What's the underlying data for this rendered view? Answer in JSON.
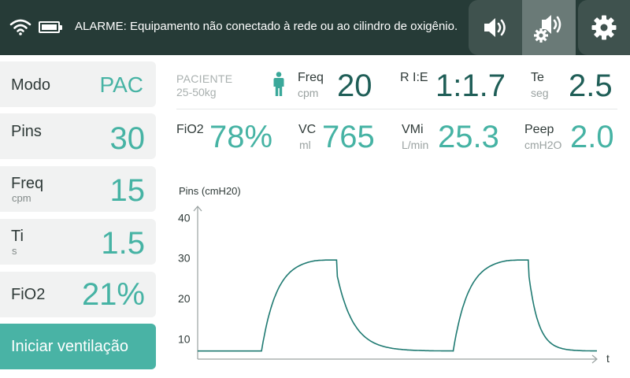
{
  "topbar": {
    "wifi_icon": "wifi-icon",
    "battery_icon": "battery-icon",
    "battery_level": 1.0,
    "alarm_text": "ALARME: Equipamento não conectado à rede ou ao cilindro de oxigênio.",
    "buttons": [
      {
        "name": "mute-alarm-button",
        "icon": "speaker-icon"
      },
      {
        "name": "alarm-settings-button",
        "icon": "speaker-gear-icon"
      },
      {
        "name": "settings-button",
        "icon": "gear-icon"
      }
    ]
  },
  "settings": {
    "mode": {
      "label": "Modo",
      "value": "PAC"
    },
    "pins": {
      "label": "Pins",
      "value": "30"
    },
    "freq": {
      "label": "Freq",
      "unit": "cpm",
      "value": "15"
    },
    "ti": {
      "label": "Ti",
      "unit": "s",
      "value": "1.5"
    },
    "fio2": {
      "label": "FiO2",
      "value": "21%"
    },
    "start_label": "Iniciar ventilação"
  },
  "monitor": {
    "patient_label": "PACIENTE",
    "patient_range": "25-50kg",
    "patient_icon": "person-icon",
    "freq": {
      "label": "Freq",
      "unit": "cpm",
      "value": "20"
    },
    "rie": {
      "label": "R I:E",
      "value": "1:1.7"
    },
    "te": {
      "label": "Te",
      "unit": "seg",
      "value": "2.5"
    },
    "fio2": {
      "label": "FiO2",
      "value": "78%"
    },
    "vc": {
      "label": "VC",
      "unit": "ml",
      "value": "765"
    },
    "vmi": {
      "label": "VMi",
      "unit": "L/min",
      "value": "25.3"
    },
    "peep": {
      "label": "Peep",
      "unit": "cmH2O",
      "value": "2.0"
    }
  },
  "chart_data": {
    "type": "line",
    "ylabel": "Pins (cmH20)",
    "xlabel": "t",
    "yticks": [
      10,
      20,
      30,
      40
    ],
    "ylim": [
      5,
      42
    ],
    "grid": false,
    "colors": {
      "line": "#1f7a72",
      "axis": "#9aa2a1",
      "text": "#2f3a38"
    },
    "waveform": {
      "baseline": 7,
      "peak": 30,
      "breaths": [
        {
          "rise_start": 0.16,
          "fall_start": 0.35
        },
        {
          "rise_start": 0.64,
          "fall_start": 0.83
        }
      ],
      "end": 1.0
    }
  }
}
